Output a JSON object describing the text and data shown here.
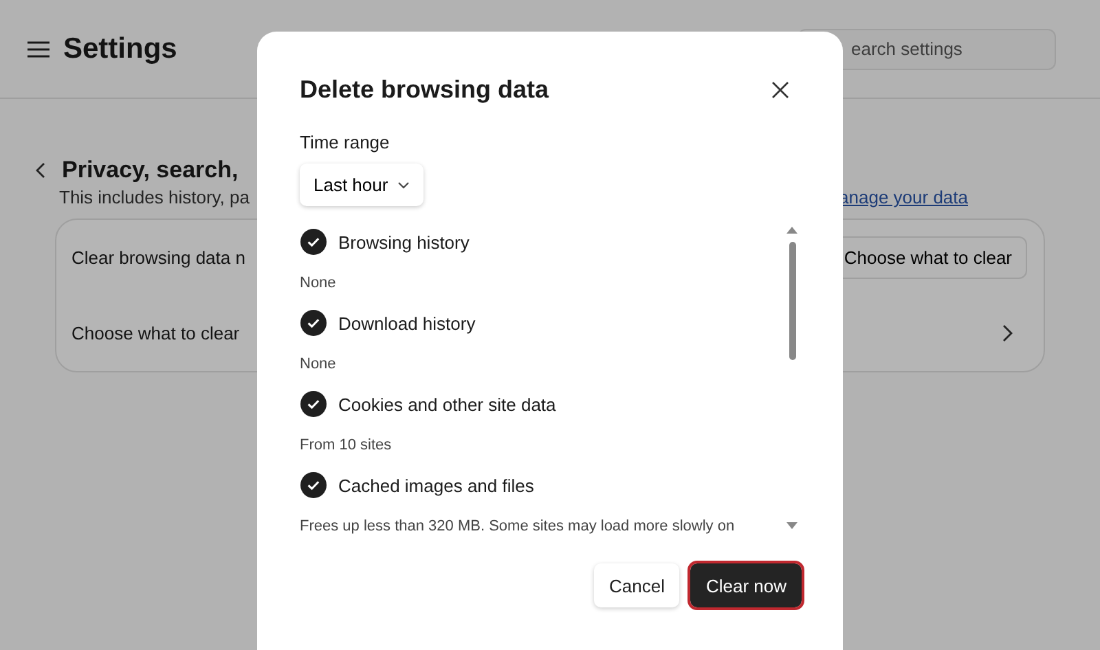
{
  "settings": {
    "title": "Settings",
    "search": {
      "placeholder": "earch settings"
    },
    "section": {
      "title": "Privacy, search,",
      "subtitle": "This includes history, pa",
      "link": "anage your data"
    },
    "rows": [
      {
        "kind": "button",
        "label": "Clear browsing data n",
        "button": "Choose what to clear"
      },
      {
        "kind": "chevron",
        "label": "Choose what to clear"
      }
    ]
  },
  "dialog": {
    "title": "Delete browsing data",
    "time_range": {
      "label": "Time range",
      "value": "Last hour"
    },
    "items": [
      {
        "label": "Browsing history",
        "checked": true,
        "detail": "None"
      },
      {
        "label": "Download history",
        "checked": true,
        "detail": "None"
      },
      {
        "label": "Cookies and other site data",
        "checked": true,
        "detail": "From 10 sites"
      },
      {
        "label": "Cached images and files",
        "checked": true,
        "detail": "Frees up less than 320 MB. Some sites may load more slowly on"
      }
    ],
    "buttons": [
      {
        "kind": "secondary",
        "label": "Cancel",
        "highlighted": false
      },
      {
        "kind": "primary",
        "label": "Clear now",
        "highlighted": true
      }
    ]
  }
}
